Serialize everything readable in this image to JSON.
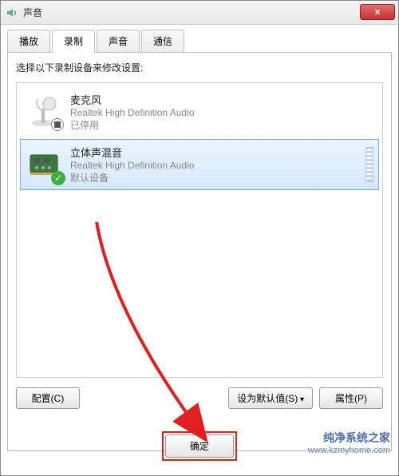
{
  "window": {
    "title": "声音"
  },
  "tabs": {
    "items": [
      {
        "label": "播放"
      },
      {
        "label": "录制"
      },
      {
        "label": "声音"
      },
      {
        "label": "通信"
      }
    ],
    "active_index": 1
  },
  "instruction": "选择以下录制设备来修改设置:",
  "devices": [
    {
      "name": "麦克风",
      "description": "Realtek High Definition Audio",
      "status": "已停用",
      "icon": "microphone-icon",
      "badge": "disabled",
      "selected": false
    },
    {
      "name": "立体声混音",
      "description": "Realtek High Definition Audio",
      "status": "默认设备",
      "icon": "soundcard-icon",
      "badge": "default",
      "selected": true
    }
  ],
  "buttons": {
    "configure": "配置(C)",
    "set_default": "设为默认值(S)",
    "properties": "属性(P)",
    "ok": "确定"
  },
  "watermark": {
    "line1": "纯净系统之家",
    "line2": "www.kzmyhome.com"
  },
  "close_label": "×"
}
